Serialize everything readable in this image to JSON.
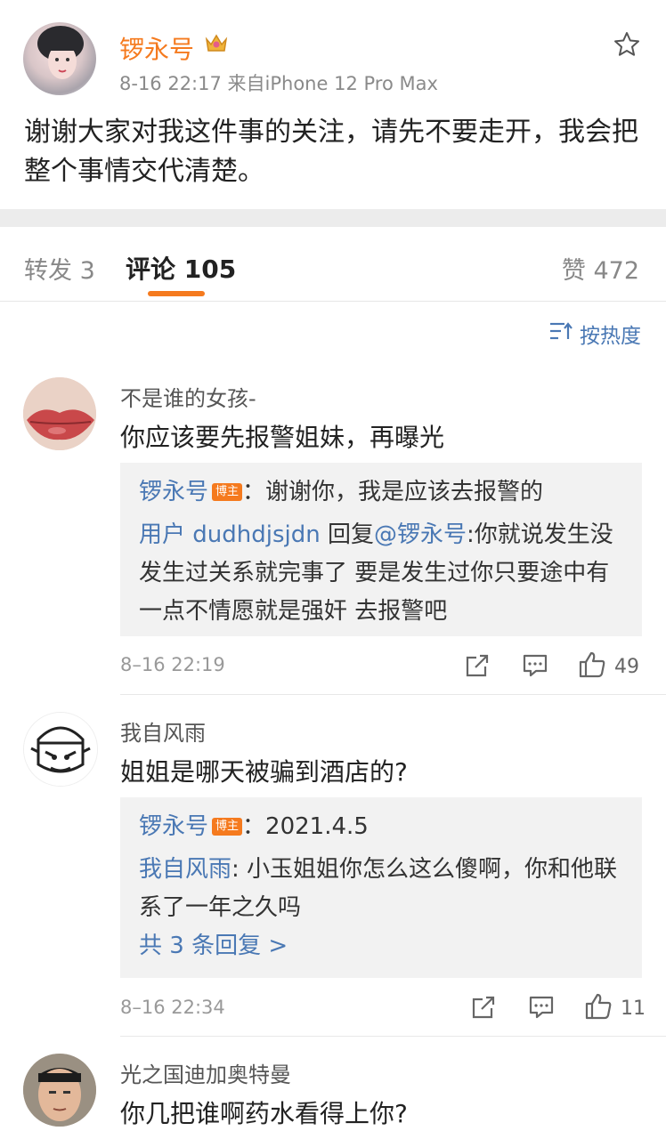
{
  "post": {
    "author": "锣永号",
    "crown_icon": "crown-icon",
    "meta": "8-16 22:17  来自iPhone 12 Pro Max",
    "text": "谢谢大家对我这件事的关注，请先不要走开，我会把整个事情交代清楚。"
  },
  "tabs": {
    "repost": "转发 3",
    "comments": "评论 105",
    "likes": "赞 472"
  },
  "sort": {
    "label": "按热度",
    "icon": "sort-icon"
  },
  "comments": [
    {
      "name": "不是谁的女孩-",
      "text": "你应该要先报警姐妹，再曝光",
      "replies": [
        {
          "author": "锣永号",
          "badge": "博主",
          "sep": "：",
          "text": "谢谢你，我是应该去报警的"
        },
        {
          "author": "用户 dudhdjsjdn",
          "mid": "回复",
          "mention": "@锣永号",
          "text": ":你就说发生没发生过关系就完事了 要是发生过你只要途中有一点不情愿就是强奸 去报警吧"
        }
      ],
      "time": "8–16 22:19",
      "likes": "49"
    },
    {
      "name": "我自风雨",
      "text": "姐姐是哪天被骗到酒店的?",
      "replies": [
        {
          "author": "锣永号",
          "badge": "博主",
          "sep": "：",
          "text": "2021.4.5"
        },
        {
          "author": "我自风雨",
          "sep": ": ",
          "text": "小玉姐姐你怎么这么傻啊，你和他联系了一年之久吗"
        }
      ],
      "more": "共 3 条回复 >",
      "time": "8–16 22:34",
      "likes": "11"
    },
    {
      "name": "光之国迪加奥特曼",
      "text": "你几把谁啊药水看得上你?"
    }
  ],
  "colors": {
    "accent": "#f57a1e",
    "link": "#4a78b4"
  }
}
